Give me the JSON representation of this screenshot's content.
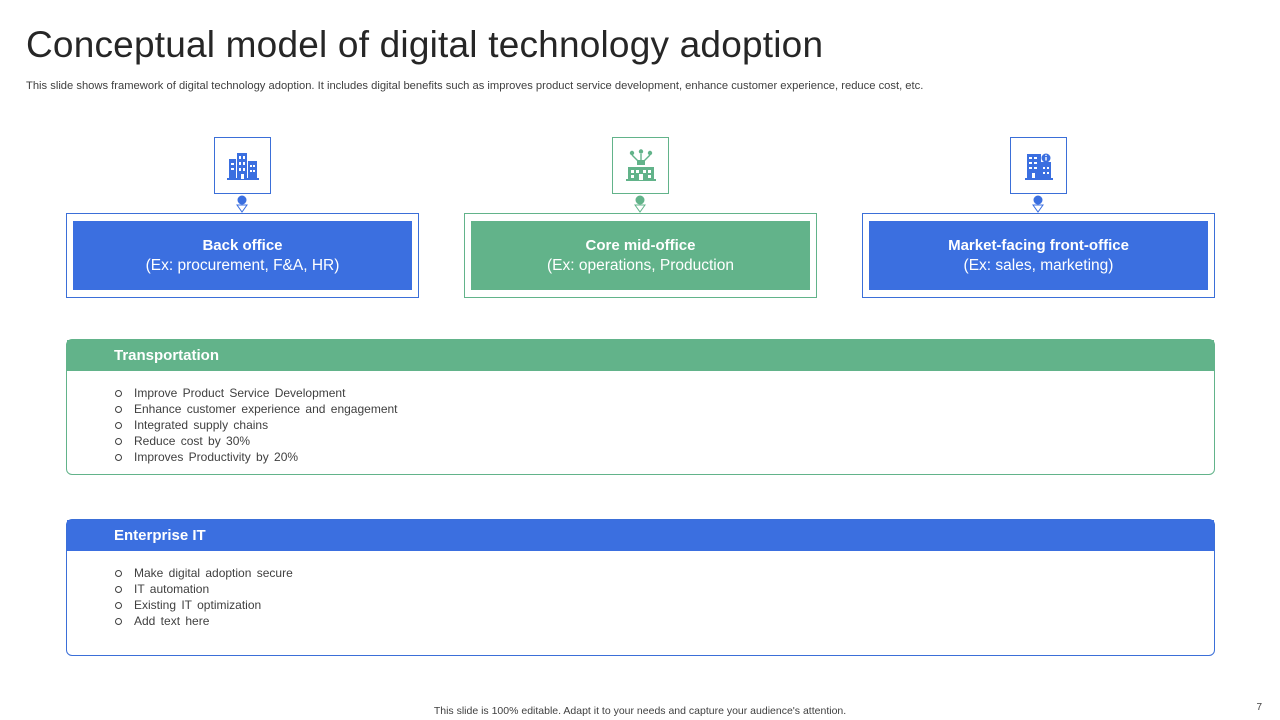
{
  "slide": {
    "title": "Conceptual model of digital technology adoption",
    "subtitle": "This slide shows framework of digital technology adoption. It includes digital benefits such as improves product service development, enhance customer experience, reduce cost, etc.",
    "footer": "This slide is 100% editable.  Adapt it to your needs and capture your audience's attention.",
    "page_number": "7"
  },
  "colors": {
    "blue": "#3b6fe0",
    "green": "#62b38a"
  },
  "offices": [
    {
      "title": "Back office",
      "subtitle": "(Ex: procurement, F&A, HR)",
      "icon": "buildings-icon",
      "color": "blue"
    },
    {
      "title": "Core mid-office",
      "subtitle": "(Ex: operations, Production",
      "icon": "network-building-icon",
      "color": "green"
    },
    {
      "title": "Market-facing front-office",
      "subtitle": "(Ex: sales, marketing)",
      "icon": "office-building-info-icon",
      "color": "blue"
    }
  ],
  "panels": [
    {
      "title": "Transportation",
      "color": "green",
      "items": [
        "Improve  Product Service  Development",
        "Enhance customer experience  and engagement",
        "Integrated  supply chains",
        "Reduce cost by 30%",
        "Improves  Productivity  by 20%"
      ]
    },
    {
      "title": "Enterprise IT",
      "color": "blue",
      "items": [
        "Make digital adoption  secure",
        "IT automation",
        "Existing IT optimization",
        "Add text here"
      ]
    }
  ]
}
